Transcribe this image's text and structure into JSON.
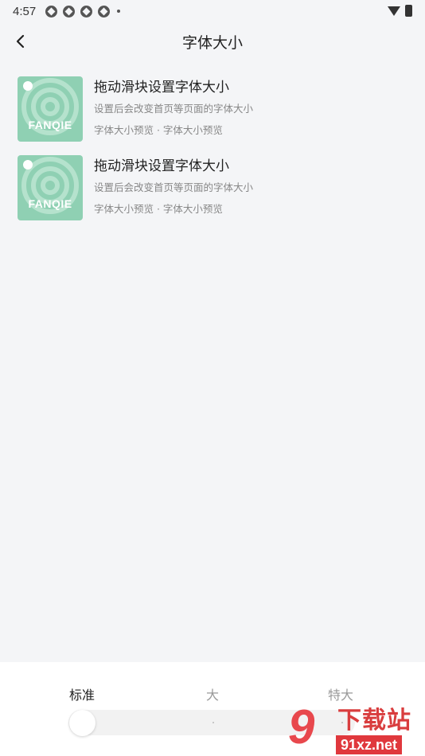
{
  "status_bar": {
    "time": "4:57"
  },
  "nav": {
    "title": "字体大小"
  },
  "books": [
    {
      "cover_text": "FANQIE",
      "title": "拖动滑块设置字体大小",
      "description": "设置后会改变首页等页面的字体大小",
      "meta": "字体大小预览 · 字体大小预览"
    },
    {
      "cover_text": "FANQIE",
      "title": "拖动滑块设置字体大小",
      "description": "设置后会改变首页等页面的字体大小",
      "meta": "字体大小预览 · 字体大小预览"
    }
  ],
  "font_size": {
    "options": [
      "标准",
      "大",
      "特大"
    ],
    "selected": "标准"
  },
  "watermark": {
    "title": "下载站",
    "url": "91xz.net",
    "mark": "9"
  },
  "colors": {
    "cover": "#8fd0b3",
    "accent_red": "#e0383d"
  }
}
